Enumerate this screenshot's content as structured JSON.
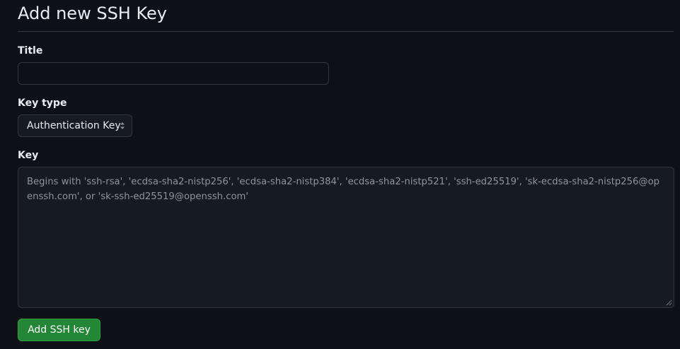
{
  "page": {
    "title": "Add new SSH Key"
  },
  "form": {
    "title_field": {
      "label": "Title",
      "value": "",
      "placeholder": ""
    },
    "key_type": {
      "label": "Key type",
      "selected": "Authentication Key"
    },
    "key_field": {
      "label": "Key",
      "value": "",
      "placeholder": "Begins with 'ssh-rsa', 'ecdsa-sha2-nistp256', 'ecdsa-sha2-nistp384', 'ecdsa-sha2-nistp521', 'ssh-ed25519', 'sk-ecdsa-sha2-nistp256@openssh.com', or 'sk-ssh-ed25519@openssh.com'"
    },
    "submit_label": "Add SSH key"
  },
  "colors": {
    "background": "#0d1117",
    "input_background": "#161b22",
    "border": "#30363d",
    "primary_button": "#238636",
    "text": "#e6edf3",
    "muted_text": "#8b949e"
  },
  "icons": {
    "select": "select-arrows-icon",
    "textarea_resize": "resize-handle-icon"
  }
}
